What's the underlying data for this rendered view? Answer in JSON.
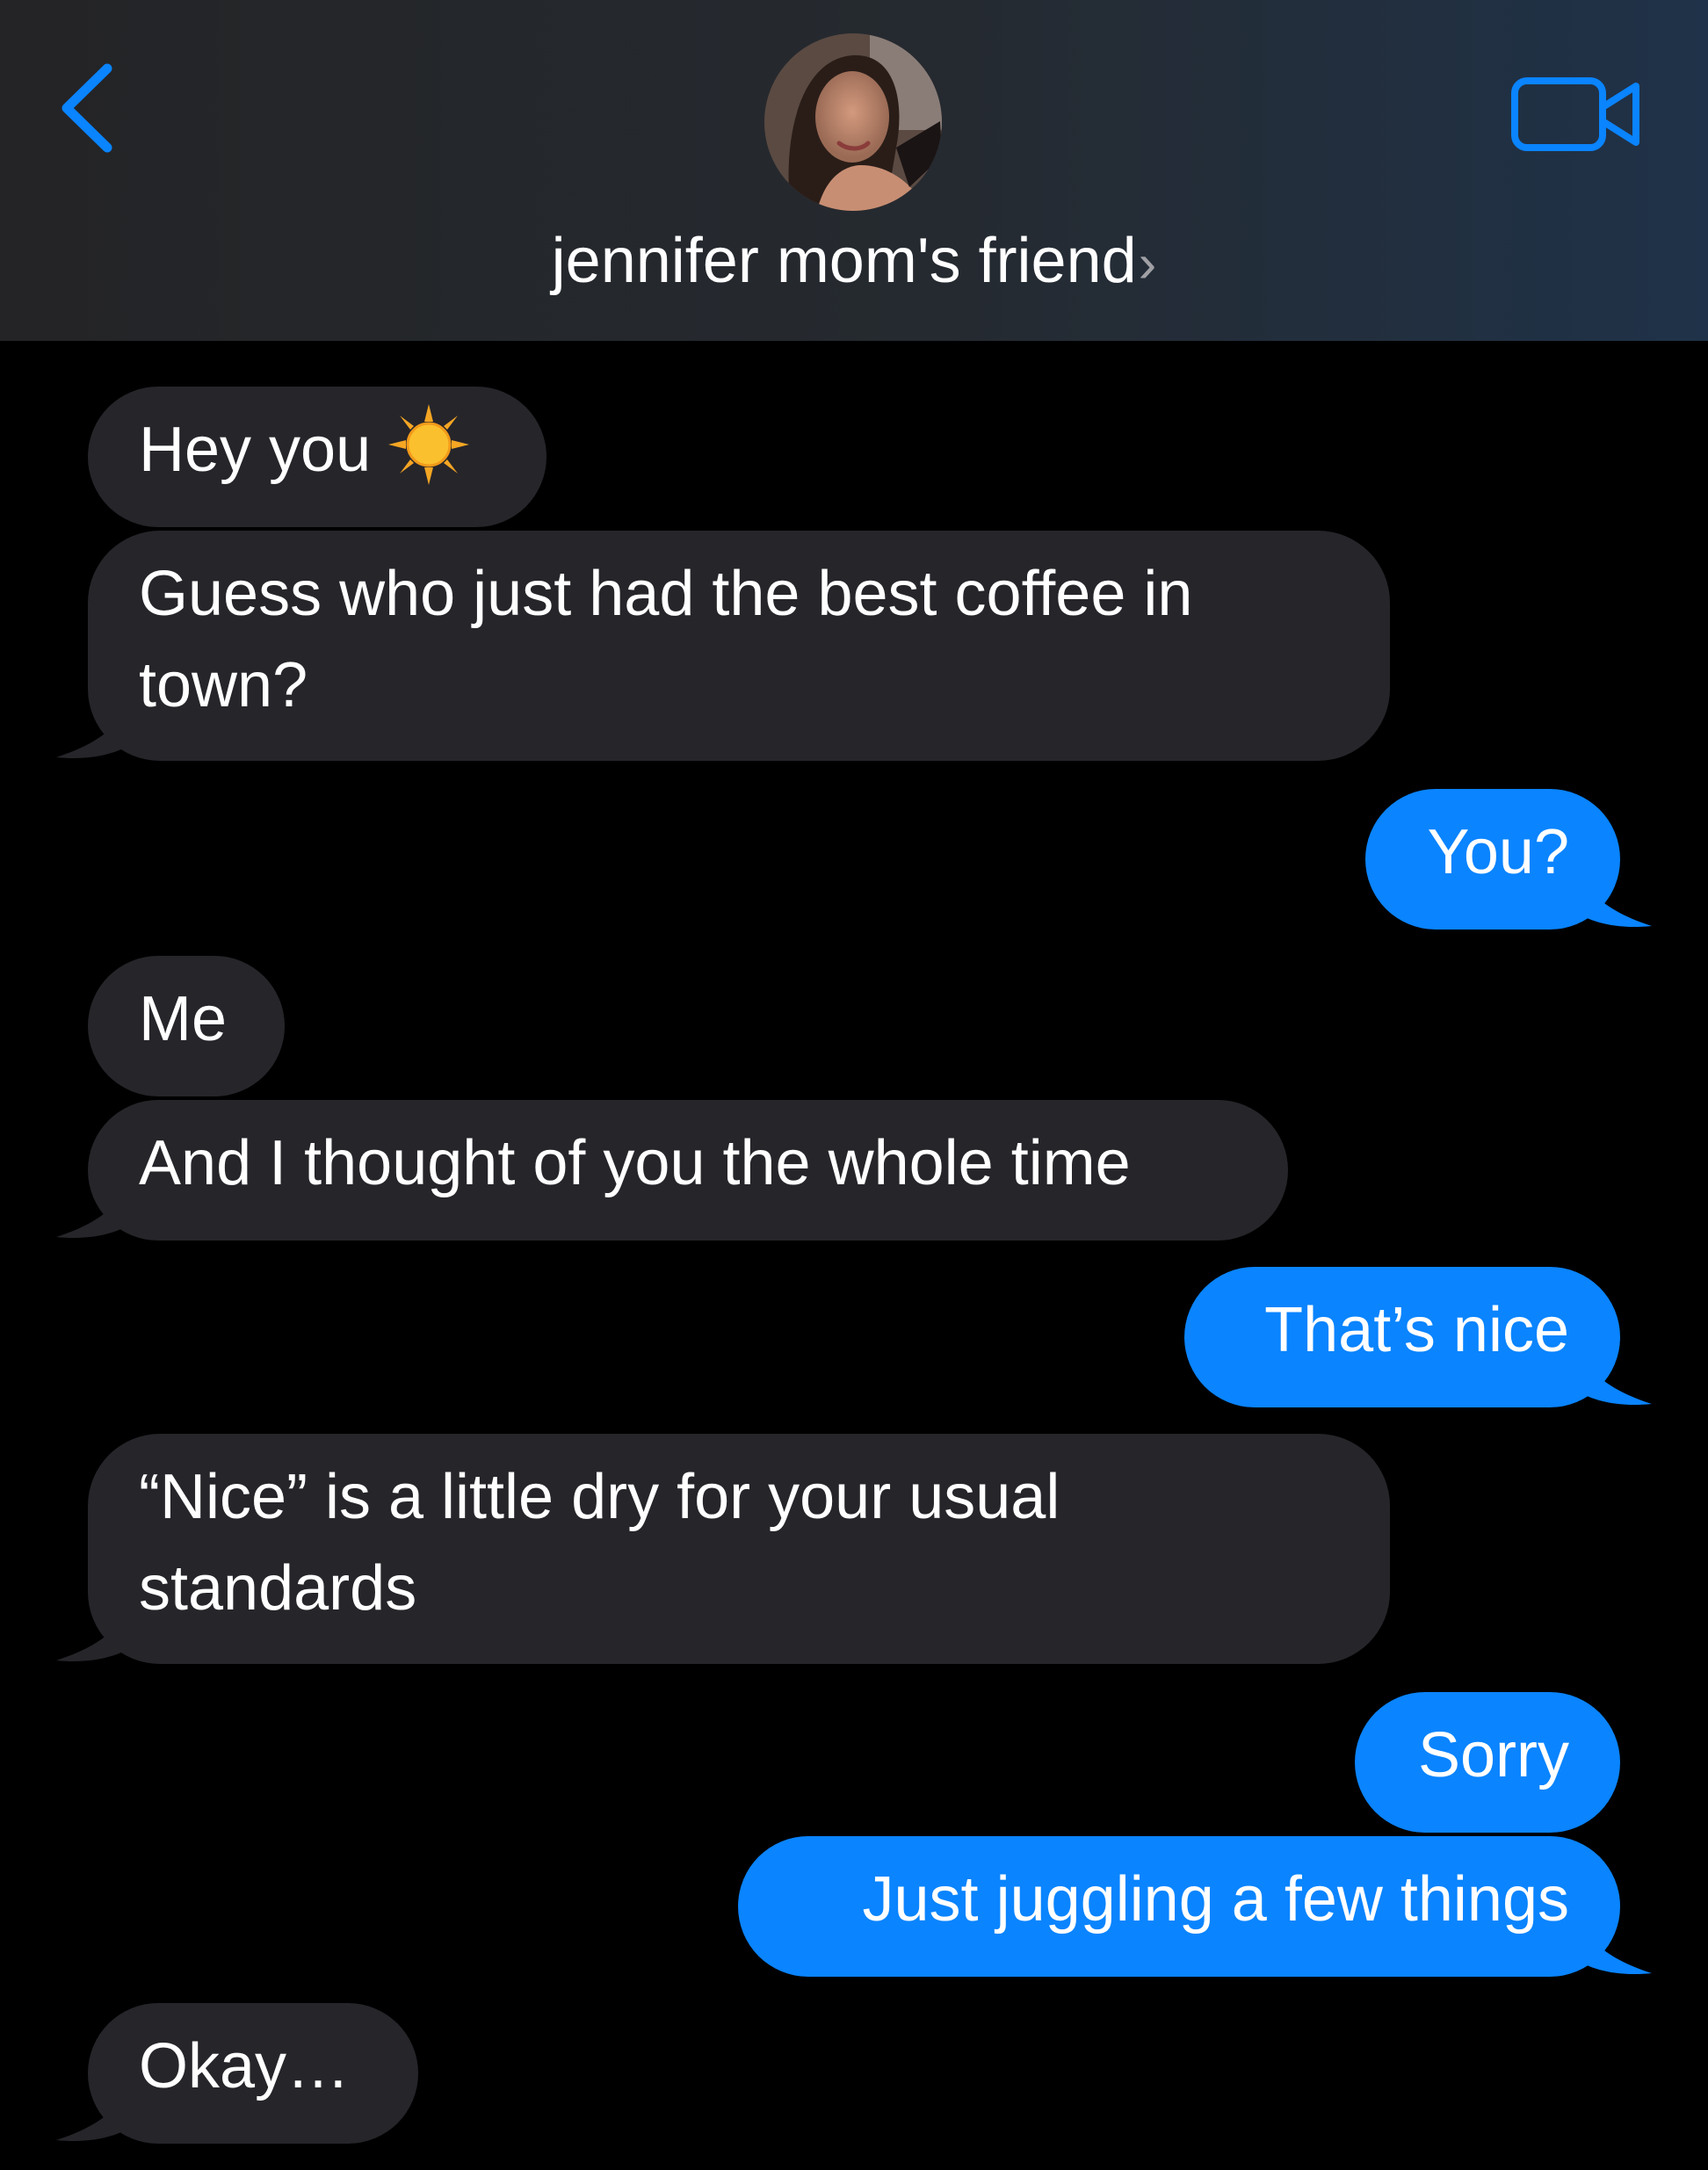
{
  "header": {
    "contact_name": "jennifer mom's friend",
    "chevron": "›",
    "back_icon": "chevron-left-icon",
    "video_icon": "video-camera-icon",
    "accent_color": "#0a84ff"
  },
  "messages": [
    {
      "direction": "received",
      "text": "Hey you",
      "emoji": "sun-emoji"
    },
    {
      "direction": "received",
      "line1": "Guess who just had the best coffee in",
      "line2": "town?"
    },
    {
      "direction": "sent",
      "text": "You?"
    },
    {
      "direction": "received",
      "text": "Me"
    },
    {
      "direction": "received",
      "text": "And I thought of you the whole time"
    },
    {
      "direction": "sent",
      "text": "That’s nice"
    },
    {
      "direction": "received",
      "line1": "“Nice” is a little dry for your usual",
      "line2": "standards"
    },
    {
      "direction": "sent",
      "text": "Sorry"
    },
    {
      "direction": "sent",
      "text": "Just juggling a few things"
    },
    {
      "direction": "received",
      "text": "Okay…"
    }
  ],
  "colors": {
    "received_bubble": "#26252a",
    "sent_bubble": "#0a84ff",
    "background": "#000000"
  }
}
